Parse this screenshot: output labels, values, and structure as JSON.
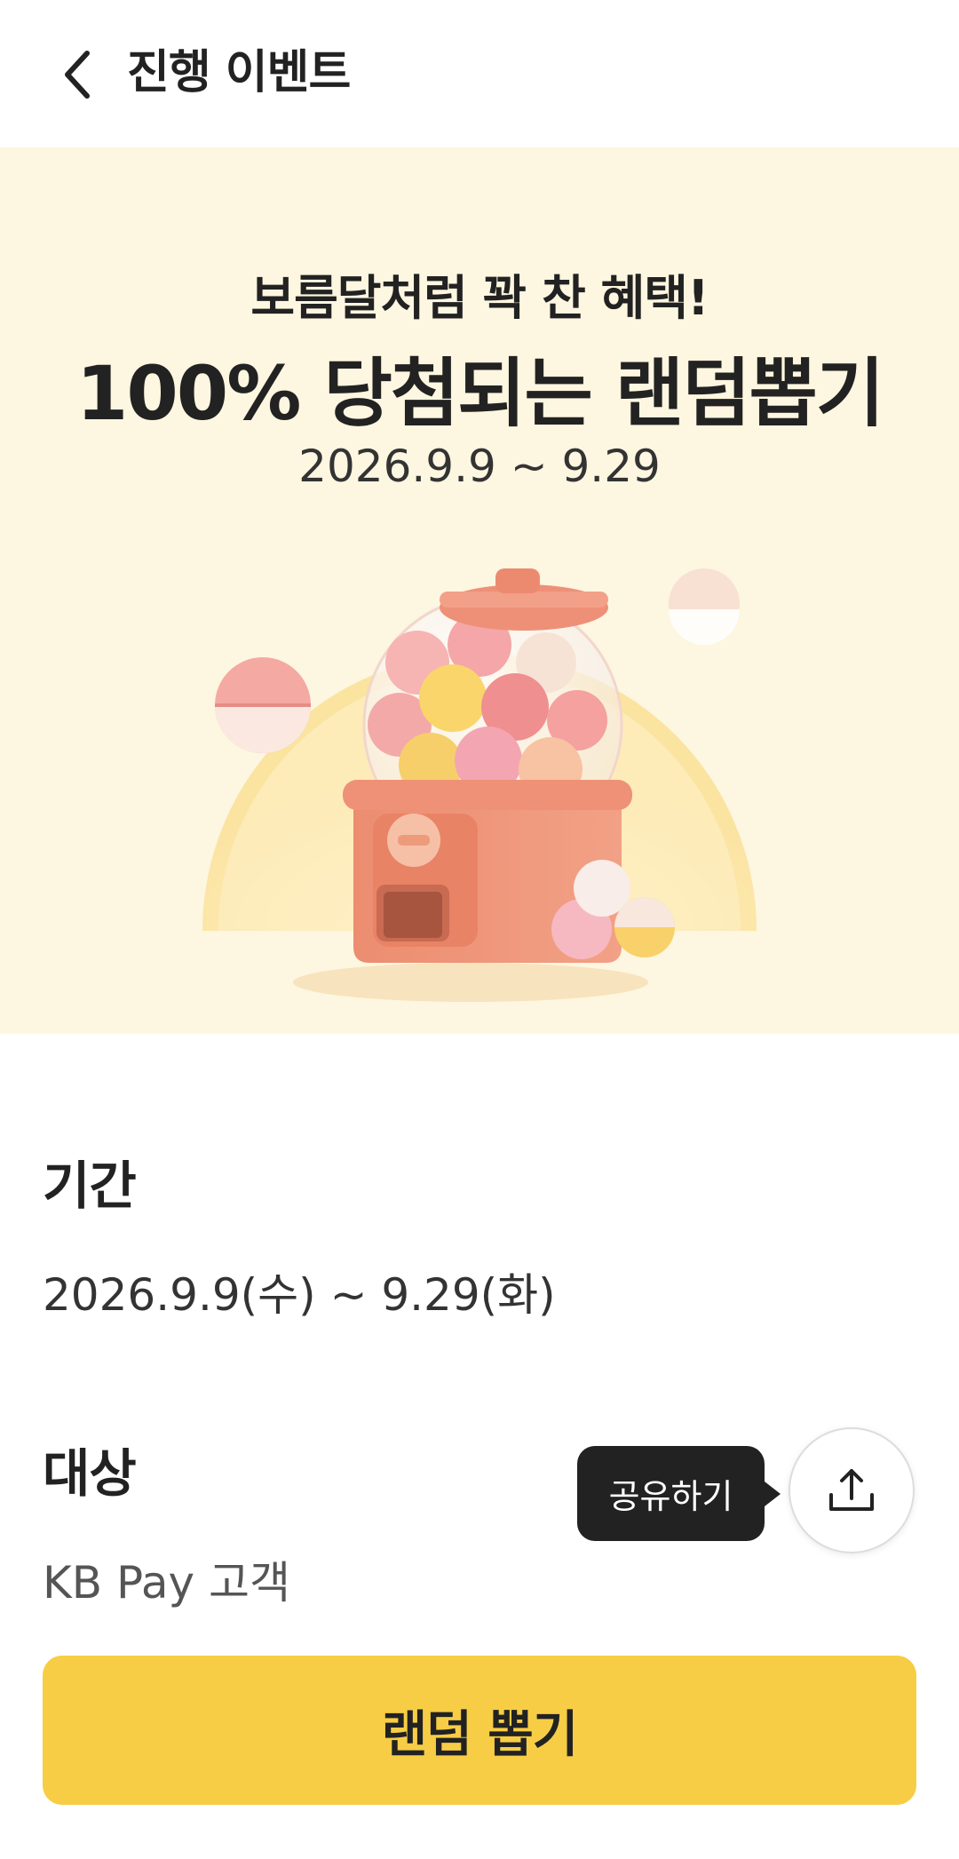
{
  "header": {
    "title": "진행 이벤트",
    "back_icon": "chevron-left-icon"
  },
  "banner": {
    "subtitle": "보름달처럼 꽉 찬 혜택!",
    "title": "100% 당첨되는 랜덤뽑기",
    "period": "2026.9.9 ~ 9.29",
    "background_color": "#fdf6e0"
  },
  "info": {
    "period_label": "기간",
    "period_value": "2026.9.9(수) ~ 9.29(화)",
    "target_label": "대상",
    "target_value": "KB Pay 고객"
  },
  "share": {
    "tooltip": "공유하기",
    "icon": "share-icon"
  },
  "cta": {
    "label": "랜덤 뽑기",
    "color": "#f7cd45"
  }
}
